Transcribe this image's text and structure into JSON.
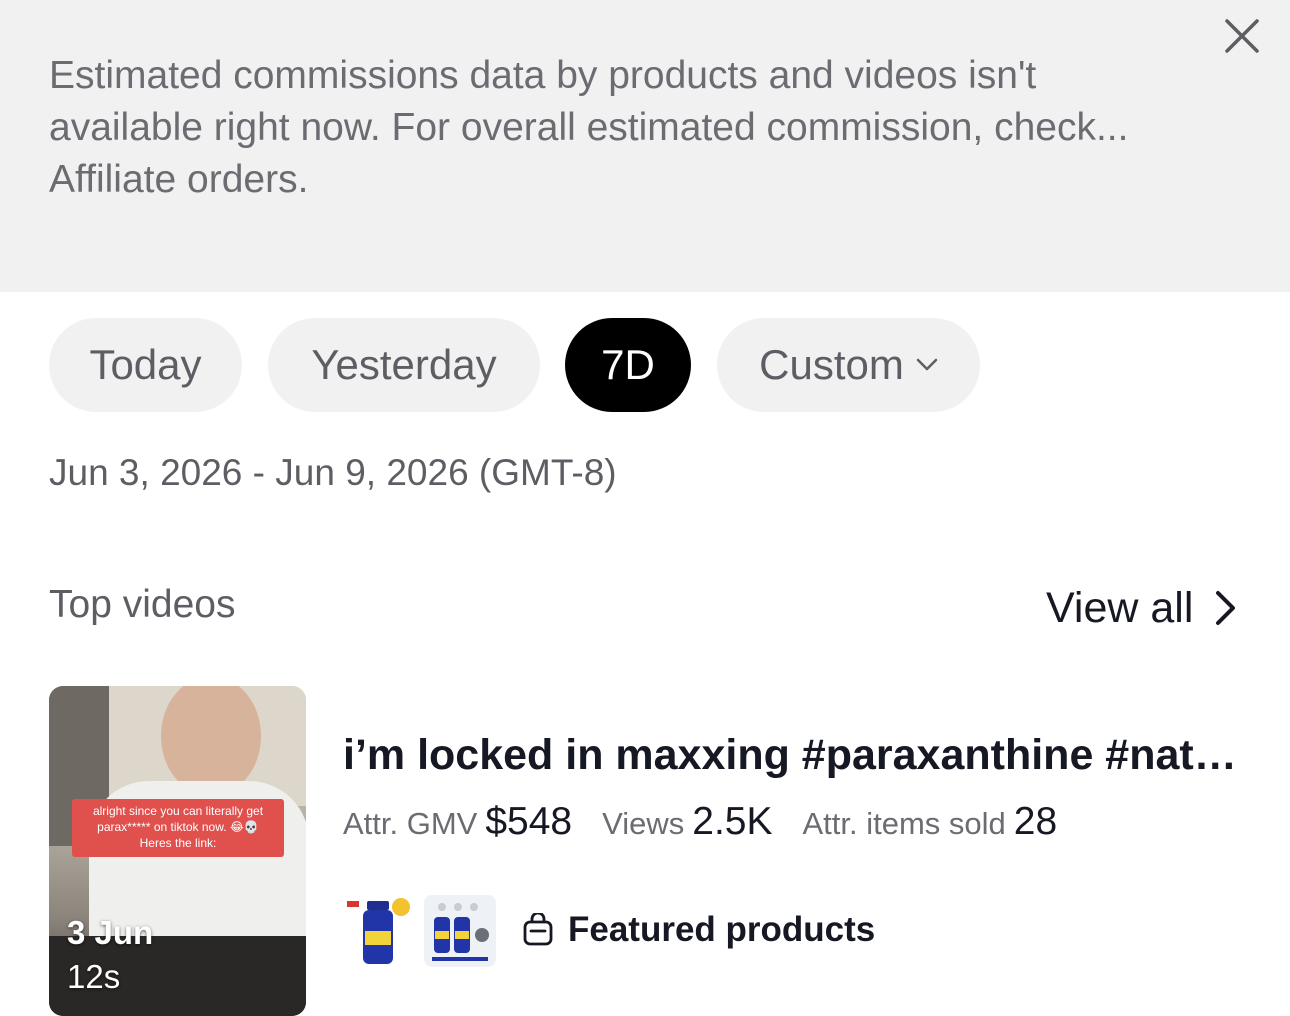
{
  "banner": {
    "line1": "Estimated commissions data by products and videos isn't",
    "line2": "available right now. For overall estimated commission, check...",
    "line3": "Affiliate orders.",
    "close_icon": "close-icon"
  },
  "filters": {
    "today": "Today",
    "yesterday": "Yesterday",
    "seven_days": "7D",
    "custom": "Custom",
    "selected": "7D"
  },
  "date_range": "Jun 3, 2026 - Jun 9, 2026 (GMT-8)",
  "top_videos": {
    "title": "Top videos",
    "view_all": "View all",
    "video": {
      "caption_line1": "alright since you can literally get",
      "caption_line2": "parax***** on tiktok now. 😂💀",
      "caption_line3": "Heres the link:",
      "date": "3 Jun",
      "duration": "12s",
      "title": "i’m locked in maxxing #paraxanthine #natu...",
      "gmv_label": "Attr. GMV",
      "gmv_value": "$548",
      "views_label": "Views",
      "views_value": "2.5K",
      "items_label": "Attr. items sold",
      "items_value": "28",
      "featured_label": "Featured products"
    }
  },
  "colors": {
    "banner_bg": "#f1f1f2",
    "pill_bg": "#f1f1f2",
    "active_pill_bg": "#000000",
    "caption_red": "#e0504d"
  }
}
